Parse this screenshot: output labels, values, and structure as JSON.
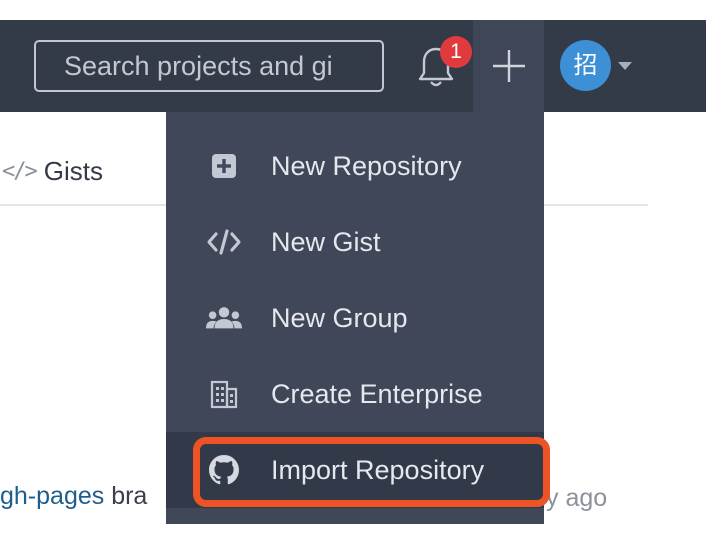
{
  "header": {
    "search": {
      "placeholder": "Search projects and gi",
      "value": ""
    },
    "notifications": {
      "count": "1",
      "icon": "bell-icon"
    },
    "create": {
      "icon": "plus-icon"
    },
    "avatar": {
      "initial": "招",
      "color": "#3d8fd6"
    }
  },
  "page": {
    "tabs": [
      {
        "icon": "code-icon",
        "glyph": "</>",
        "label": "Gists"
      }
    ],
    "activity": {
      "branch": "gh-pages",
      "after_branch": " bra",
      "time": "y ago"
    }
  },
  "dropdown": {
    "items": [
      {
        "icon": "plus-square-icon",
        "label": "New Repository"
      },
      {
        "icon": "code-icon",
        "label": "New Gist"
      },
      {
        "icon": "users-icon",
        "label": "New Group"
      },
      {
        "icon": "building-icon",
        "label": "Create Enterprise"
      },
      {
        "icon": "github-icon",
        "label": "Import Repository"
      }
    ],
    "highlighted_item": "Import Repository"
  },
  "colors": {
    "topbar": "#333a48",
    "dropdown": "#404759",
    "highlight": "#ee5325",
    "badge": "#e03a3e",
    "link": "#1f5e8c"
  }
}
